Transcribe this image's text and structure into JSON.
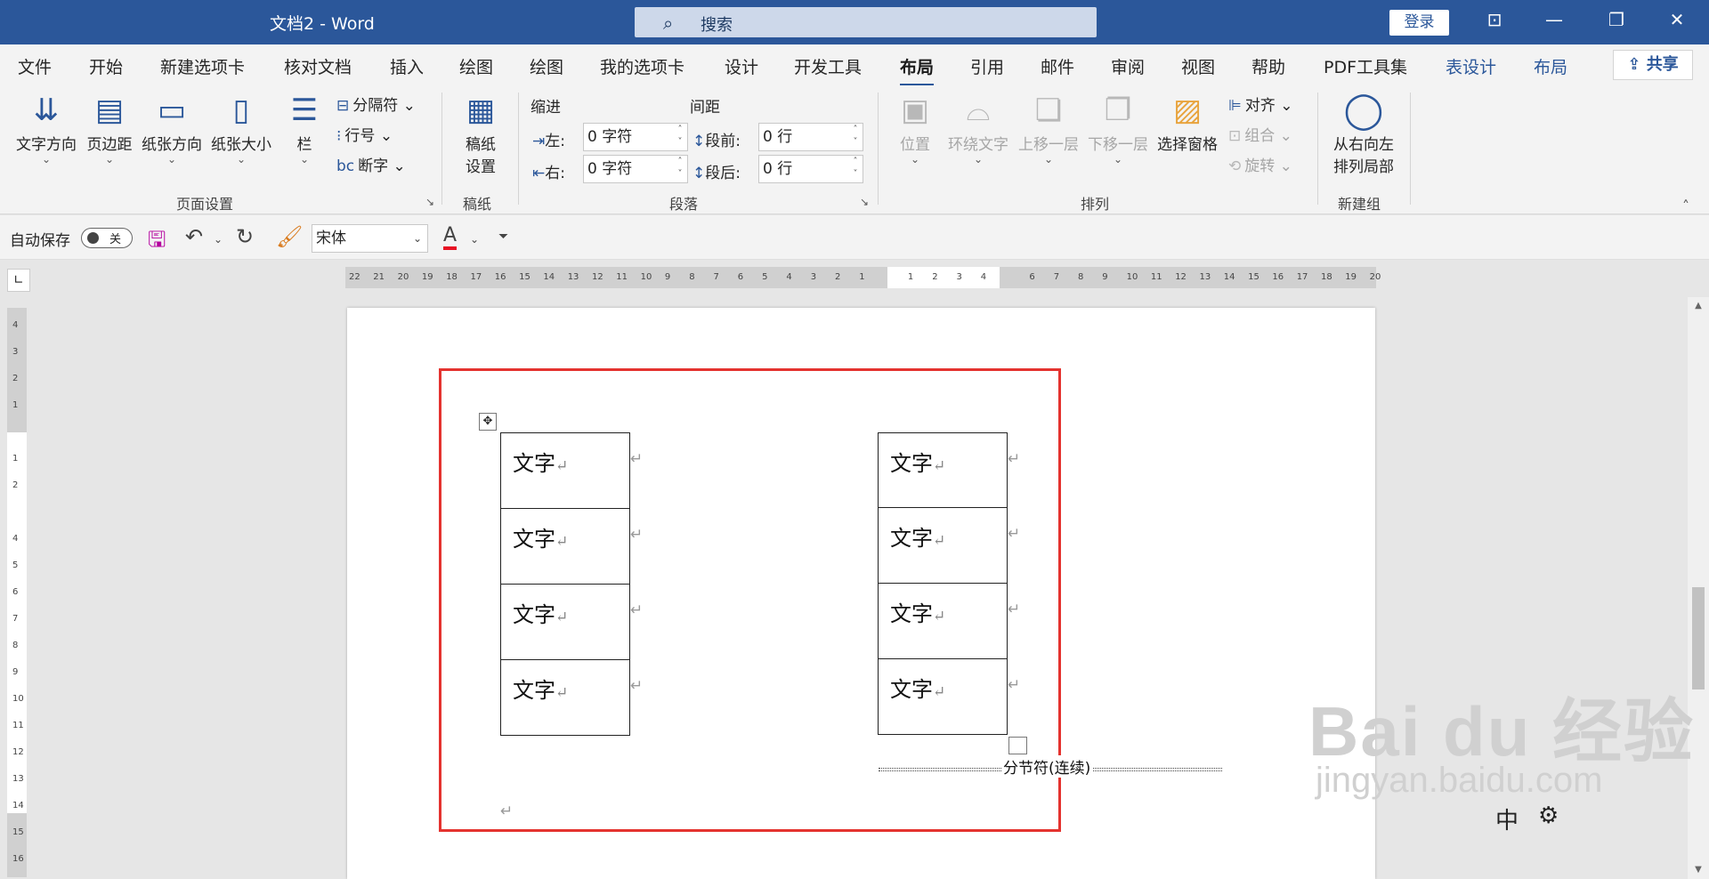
{
  "titlebar": {
    "title": "文档2  -  Word",
    "search_placeholder": "搜索",
    "login": "登录",
    "icons": [
      "search-icon",
      "ribbon-display-icon",
      "minimize-icon",
      "restore-icon",
      "close-icon"
    ]
  },
  "tabs": [
    {
      "label": "文件"
    },
    {
      "label": "开始"
    },
    {
      "label": "新建选项卡"
    },
    {
      "label": "核对文档"
    },
    {
      "label": "插入"
    },
    {
      "label": "绘图"
    },
    {
      "label": "绘图"
    },
    {
      "label": "我的选项卡"
    },
    {
      "label": "设计"
    },
    {
      "label": "开发工具"
    },
    {
      "label": "布局"
    },
    {
      "label": "引用"
    },
    {
      "label": "邮件"
    },
    {
      "label": "审阅"
    },
    {
      "label": "视图"
    },
    {
      "label": "帮助"
    },
    {
      "label": "PDF工具集"
    },
    {
      "label": "表设计"
    },
    {
      "label": "布局"
    }
  ],
  "share_label": "共享",
  "ribbon": {
    "page_setup": {
      "group_label": "页面设置",
      "text_direction": "文字方向",
      "margins": "页边距",
      "orientation": "纸张方向",
      "size": "纸张大小",
      "columns": "栏",
      "breaks": "分隔符",
      "line_numbers": "行号",
      "hyphenation": "断字"
    },
    "manuscript": {
      "group_label": "稿纸",
      "button": "稿纸\n设置",
      "button_l1": "稿纸",
      "button_l2": "设置"
    },
    "paragraph": {
      "group_label": "段落",
      "indent_header": "缩进",
      "spacing_header": "间距",
      "left_label": "左:",
      "left_value": "0 字符",
      "right_label": "右:",
      "right_value": "0 字符",
      "before_label": "段前:",
      "before_value": "0 行",
      "after_label": "段后:",
      "after_value": "0 行"
    },
    "arrange": {
      "group_label": "排列",
      "position": "位置",
      "wrap_text": "环绕文字",
      "bring_forward": "上移一层",
      "send_backward": "下移一层",
      "selection_pane": "选择窗格",
      "align": "对齐",
      "group": "组合",
      "rotate": "旋转"
    },
    "new_group": {
      "group_label": "新建组",
      "rtl_l1": "从右向左",
      "rtl_l2": "排列局部"
    }
  },
  "qat": {
    "autosave": "自动保存",
    "toggle_state": "关",
    "font": "宋体",
    "font_color": "#e81123"
  },
  "hruler_ticks": [
    "22",
    "21",
    "20",
    "19",
    "18",
    "17",
    "16",
    "15",
    "14",
    "13",
    "12",
    "11",
    "10",
    "9",
    "8",
    "7",
    "6",
    "5",
    "4",
    "3",
    "2",
    "1",
    "",
    "1",
    "2",
    "3",
    "4",
    "",
    "6",
    "7",
    "8",
    "9",
    "10",
    "11",
    "12",
    "13",
    "14",
    "15",
    "16",
    "17",
    "18",
    "19",
    "20"
  ],
  "vruler_ticks": [
    "4",
    "3",
    "2",
    "1",
    "",
    "1",
    "2",
    "",
    "4",
    "5",
    "6",
    "7",
    "8",
    "9",
    "10",
    "11",
    "12",
    "13",
    "14",
    "15",
    "16"
  ],
  "document": {
    "cell_text": "文字",
    "paragraph_mark": "↵",
    "left_table": [
      "文字",
      "文字",
      "文字",
      "文字"
    ],
    "right_table": [
      "文字",
      "文字",
      "文字",
      "文字"
    ],
    "section_break": "分节符(连续)"
  },
  "watermark": {
    "logo": "Bai du 经验",
    "url": "jingyan.baidu.com"
  },
  "ime": {
    "mode": "中",
    "settings_icon": "gear-icon"
  },
  "colors": {
    "titlebar": "#2b579a",
    "highlight": "#e4332f",
    "accent": "#2b579a"
  }
}
